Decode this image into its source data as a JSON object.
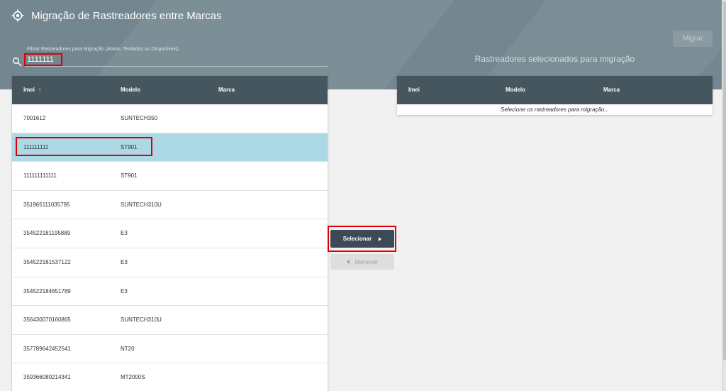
{
  "header": {
    "title": "Migração de Rastreadores entre Marcas",
    "icon": "target-icon",
    "background_color": "#748790"
  },
  "filter": {
    "label": "Filtrar Rastreadores para Migração (Ativos, Testados ou Disponíveis)",
    "value": "1111111",
    "icon": "search-icon"
  },
  "actions": {
    "migrar_label": "Migrar",
    "selecionar_label": "Selecionar",
    "remover_label": "Remover"
  },
  "available_table": {
    "columns": {
      "imei": "Imei",
      "modelo": "Modelo",
      "marca": "Marca"
    },
    "sort_indicator": "↑",
    "rows": [
      {
        "imei": "7001612",
        "modelo": "SUNTECH350",
        "marca": ""
      },
      {
        "imei": "111111111",
        "modelo": "ST901",
        "marca": ""
      },
      {
        "imei": "111111111111",
        "modelo": "ST901",
        "marca": ""
      },
      {
        "imei": "351965111035795",
        "modelo": "SUNTECH310U",
        "marca": ""
      },
      {
        "imei": "354522181195889",
        "modelo": "E3",
        "marca": ""
      },
      {
        "imei": "354522181537122",
        "modelo": "E3",
        "marca": ""
      },
      {
        "imei": "354522184651789",
        "modelo": "E3",
        "marca": ""
      },
      {
        "imei": "356430070160865",
        "modelo": "SUNTECH310U",
        "marca": ""
      },
      {
        "imei": "357789642452541",
        "modelo": "NT20",
        "marca": ""
      },
      {
        "imei": "359366080214341",
        "modelo": "MT2000S",
        "marca": ""
      }
    ],
    "selected_row_index": 1,
    "header_color": "#45565f",
    "selected_color": "#add8e6"
  },
  "selected_table": {
    "title": "Rastreadores selecionados para migração",
    "columns": {
      "imei": "Imei",
      "modelo": "Modelo",
      "marca": "Marca"
    },
    "empty_message": "Selecione os rastreadores para migração..."
  },
  "colors": {
    "annotation_red": "#e00000",
    "primary_button": "#3c4a57"
  }
}
